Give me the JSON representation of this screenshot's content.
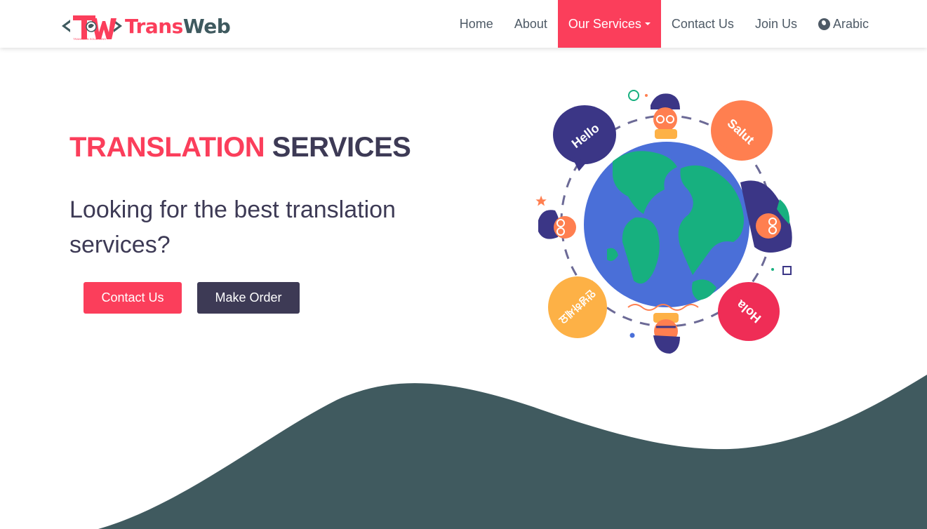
{
  "brand": {
    "name_part1": "Trans",
    "name_part2": "Web",
    "mark_text": "TW",
    "tagline": "TRANSWEB SOLUTIONS"
  },
  "nav": {
    "items": [
      {
        "label": "Home"
      },
      {
        "label": "About"
      },
      {
        "label": "Our Services",
        "active": true,
        "has_dropdown": true
      },
      {
        "label": "Contact Us"
      },
      {
        "label": "Join Us"
      },
      {
        "label": "Arabic",
        "icon": "globe-icon"
      }
    ]
  },
  "hero": {
    "title_part1": "TRANSLATION",
    "title_part2": "SERVICES",
    "subtitle": "Looking for the best translation services?",
    "buttons": {
      "contact": "Contact Us",
      "order": "Make Order"
    }
  },
  "illustration": {
    "bubbles": [
      "Hello",
      "Salut",
      "Hola",
      "안녕하세요"
    ]
  },
  "colors": {
    "accent": "#fb3e5b",
    "dark": "#3d3a55",
    "wave": "#405a5f",
    "nav_text": "#4e5a66"
  }
}
